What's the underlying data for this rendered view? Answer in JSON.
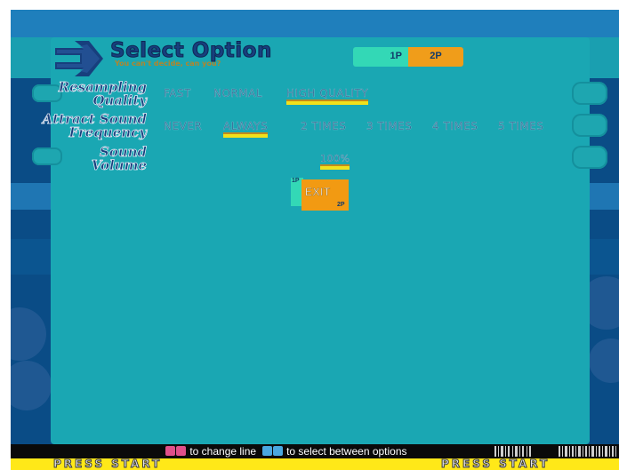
{
  "header": {
    "title": "Select Option",
    "subtitle": "You can't decide, can you?",
    "player_tabs": [
      "1P",
      "2P"
    ]
  },
  "rows": [
    {
      "label_line1": "Resampling",
      "label_line2": "Quality",
      "options": [
        "FAST",
        "NORMAL",
        "HIGH QUALITY"
      ],
      "selected": "HIGH QUALITY"
    },
    {
      "label_line1": "Attract Sound",
      "label_line2": "Frequency",
      "options": [
        "NEVER",
        "ALWAYS",
        "2 TIMES",
        "3 TIMES",
        "4 TIMES",
        "5 TIMES"
      ],
      "selected": "ALWAYS"
    },
    {
      "label_line1": "Sound",
      "label_line2": "Volume",
      "options": [
        "100%"
      ],
      "selected": "100%"
    }
  ],
  "exit": {
    "label": "EXIT",
    "tag_1p": "1P",
    "tag_2p": "2P"
  },
  "help": {
    "change_line": "to change line",
    "select_options": "to select between options"
  },
  "footer": {
    "press_start_left": "PRESS START",
    "press_start_right": "PRESS START"
  },
  "colors": {
    "panel": "#1aa7b3",
    "background": "#0a4c86",
    "selection_player1": "#33d8b6",
    "selection_player2": "#f09d1a",
    "start_bar": "#ffe818"
  }
}
